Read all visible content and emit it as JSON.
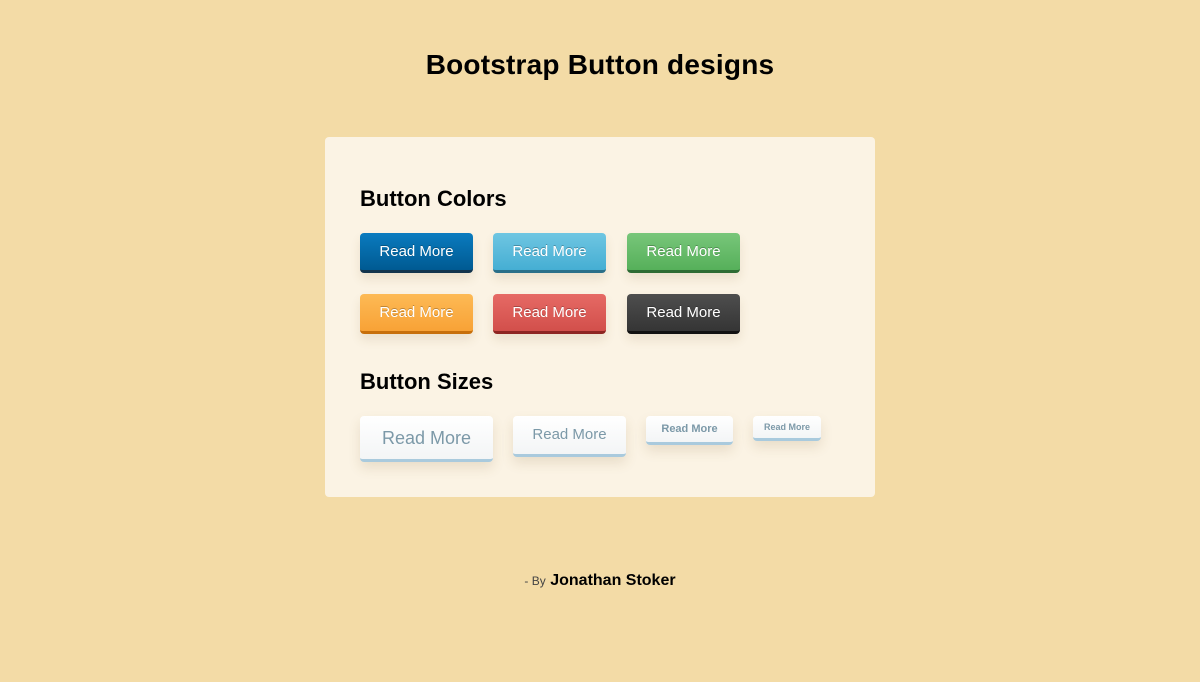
{
  "header": {
    "title": "Bootstrap Button designs"
  },
  "colors_section": {
    "heading": "Button Colors",
    "buttons": [
      {
        "label": "Read More",
        "variant": "primary",
        "color": "#0a6ba9"
      },
      {
        "label": "Read More",
        "variant": "info",
        "color": "#5bbadb"
      },
      {
        "label": "Read More",
        "variant": "success",
        "color": "#66bb6a"
      },
      {
        "label": "Read More",
        "variant": "warning",
        "color": "#fbae45"
      },
      {
        "label": "Read More",
        "variant": "danger",
        "color": "#dc5c58"
      },
      {
        "label": "Read More",
        "variant": "inverse",
        "color": "#414141"
      }
    ]
  },
  "sizes_section": {
    "heading": "Button Sizes",
    "buttons": [
      {
        "label": "Read More",
        "size": "large"
      },
      {
        "label": "Read More",
        "size": "default"
      },
      {
        "label": "Read More",
        "size": "small"
      },
      {
        "label": "Read More",
        "size": "mini"
      }
    ]
  },
  "footer": {
    "prefix": "- By",
    "author": "Jonathan Stoker"
  },
  "colors": {
    "page_background": "#f3dba6",
    "panel_background": "#fbf3e4",
    "size_button_text": "#7c99a8",
    "size_button_border": "#a9cadd"
  }
}
